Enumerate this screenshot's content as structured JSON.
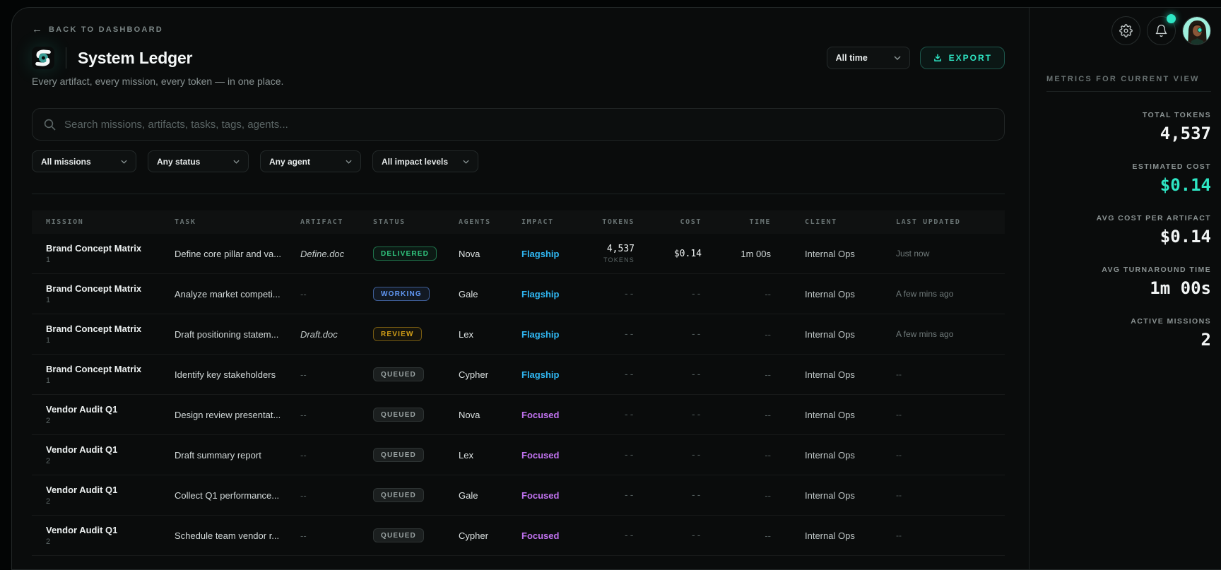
{
  "topbar": {
    "back_label": "BACK TO DASHBOARD"
  },
  "header": {
    "title": "System Ledger",
    "subtitle": "Every artifact, every mission, every token — in one place.",
    "time_range": "All time",
    "export_label": "EXPORT"
  },
  "search": {
    "placeholder": "Search missions, artifacts, tasks, tags, agents..."
  },
  "filters": [
    {
      "label": "All missions"
    },
    {
      "label": "Any status"
    },
    {
      "label": "Any agent"
    },
    {
      "label": "All impact levels"
    }
  ],
  "table": {
    "columns": [
      "MISSION",
      "TASK",
      "ARTIFACT",
      "STATUS",
      "AGENTS",
      "IMPACT",
      "TOKENS",
      "COST",
      "TIME",
      "CLIENT",
      "LAST UPDATED"
    ],
    "rows": [
      {
        "mission": "Brand Concept Matrix",
        "mission_id": "1",
        "task": "Define core pillar and va...",
        "artifact": "Define.doc",
        "status": "DELIVERED",
        "agent": "Nova",
        "impact": "Flagship",
        "tokens": "4,537",
        "tokens_unit": "TOKENS",
        "cost": "$0.14",
        "time": "1m 00s",
        "client": "Internal Ops",
        "updated": "Just now"
      },
      {
        "mission": "Brand Concept Matrix",
        "mission_id": "1",
        "task": "Analyze market competi...",
        "artifact": "--",
        "status": "WORKING",
        "agent": "Gale",
        "impact": "Flagship",
        "tokens": "--",
        "cost": "--",
        "time": "--",
        "client": "Internal Ops",
        "updated": "A few mins ago"
      },
      {
        "mission": "Brand Concept Matrix",
        "mission_id": "1",
        "task": "Draft positioning statem...",
        "artifact": "Draft.doc",
        "status": "REVIEW",
        "agent": "Lex",
        "impact": "Flagship",
        "tokens": "--",
        "cost": "--",
        "time": "--",
        "client": "Internal Ops",
        "updated": "A few mins ago"
      },
      {
        "mission": "Brand Concept Matrix",
        "mission_id": "1",
        "task": "Identify key stakeholders",
        "artifact": "--",
        "status": "QUEUED",
        "agent": "Cypher",
        "impact": "Flagship",
        "tokens": "--",
        "cost": "--",
        "time": "--",
        "client": "Internal Ops",
        "updated": "--"
      },
      {
        "mission": "Vendor Audit Q1",
        "mission_id": "2",
        "task": "Design review presentat...",
        "artifact": "--",
        "status": "QUEUED",
        "agent": "Nova",
        "impact": "Focused",
        "tokens": "--",
        "cost": "--",
        "time": "--",
        "client": "Internal Ops",
        "updated": "--"
      },
      {
        "mission": "Vendor Audit Q1",
        "mission_id": "2",
        "task": "Draft summary report",
        "artifact": "--",
        "status": "QUEUED",
        "agent": "Lex",
        "impact": "Focused",
        "tokens": "--",
        "cost": "--",
        "time": "--",
        "client": "Internal Ops",
        "updated": "--"
      },
      {
        "mission": "Vendor Audit Q1",
        "mission_id": "2",
        "task": "Collect Q1 performance...",
        "artifact": "--",
        "status": "QUEUED",
        "agent": "Gale",
        "impact": "Focused",
        "tokens": "--",
        "cost": "--",
        "time": "--",
        "client": "Internal Ops",
        "updated": "--"
      },
      {
        "mission": "Vendor Audit Q1",
        "mission_id": "2",
        "task": "Schedule team vendor r...",
        "artifact": "--",
        "status": "QUEUED",
        "agent": "Cypher",
        "impact": "Focused",
        "tokens": "--",
        "cost": "--",
        "time": "--",
        "client": "Internal Ops",
        "updated": "--"
      }
    ]
  },
  "sidebar": {
    "section_label": "METRICS FOR CURRENT VIEW",
    "metrics": [
      {
        "label": "TOTAL TOKENS",
        "value": "4,537"
      },
      {
        "label": "ESTIMATED COST",
        "value": "$0.14"
      },
      {
        "label": "AVG COST PER ARTIFACT",
        "value": "$0.14"
      },
      {
        "label": "AVG TURNAROUND TIME",
        "value": "1m 00s"
      },
      {
        "label": "ACTIVE MISSIONS",
        "value": "2"
      }
    ]
  },
  "icons": {
    "back_arrow": "←",
    "search": "magnifier",
    "chevron": "chevron-down",
    "export": "download-tray",
    "settings": "gear",
    "notifications": "bell"
  },
  "colors": {
    "accent_teal": "#2ee6c4",
    "status": {
      "DELIVERED": "#31c77f",
      "WORKING": "#6096f2",
      "REVIEW": "#d4a017",
      "QUEUED": "#9aa3a3"
    },
    "impact": {
      "Flagship": "#30b8f4",
      "Focused": "#c173f0"
    }
  }
}
